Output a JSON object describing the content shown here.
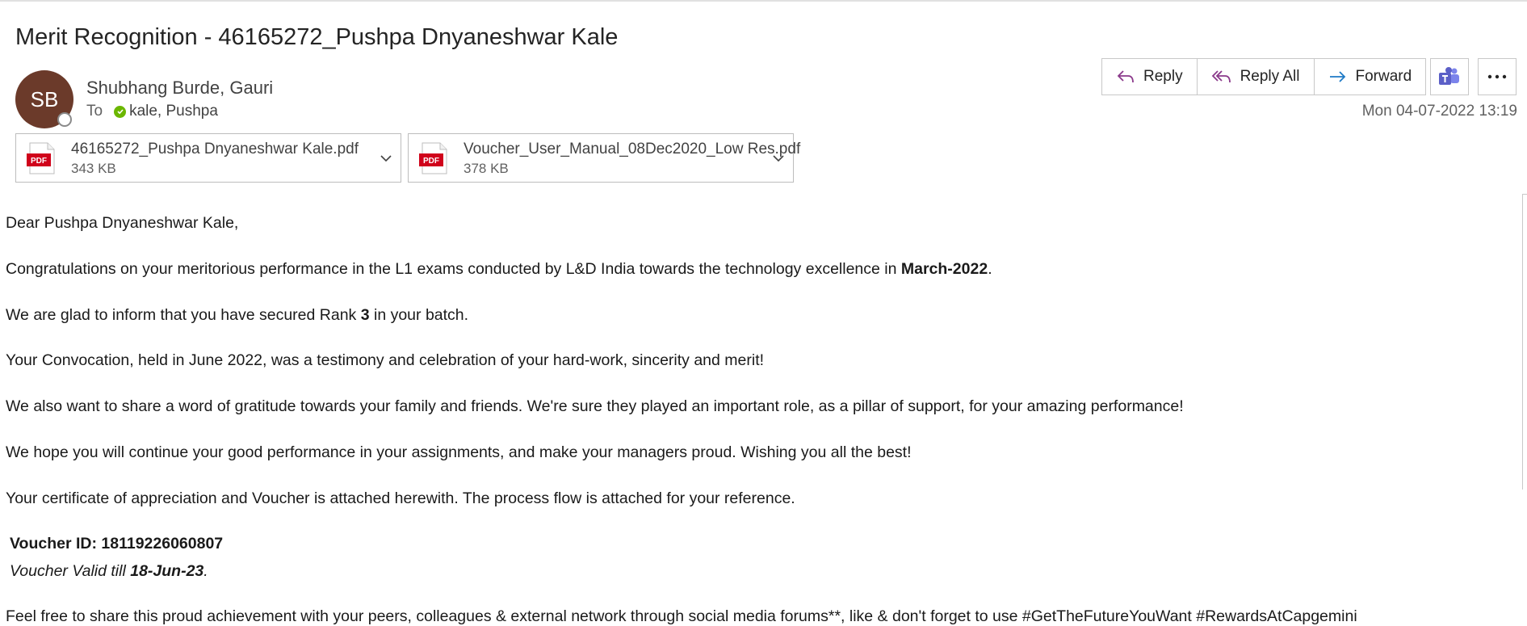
{
  "email": {
    "subject": "Merit Recognition - 46165272_Pushpa Dnyaneshwar Kale",
    "sender_initials": "SB",
    "sender_name": "Shubhang Burde, Gauri",
    "to_label": "To",
    "recipient": "kale, Pushpa",
    "date": "Mon 04-07-2022 13:19"
  },
  "actions": {
    "reply": "Reply",
    "reply_all": "Reply All",
    "forward": "Forward"
  },
  "attachments": [
    {
      "name": "46165272_Pushpa Dnyaneshwar Kale.pdf",
      "size": "343 KB",
      "badge": "PDF"
    },
    {
      "name": "Voucher_User_Manual_08Dec2020_Low Res.pdf",
      "size": "378 KB",
      "badge": "PDF"
    }
  ],
  "body": {
    "greeting": "Dear Pushpa Dnyaneshwar Kale,",
    "p1_a": "Congratulations on your meritorious performance in the L1 exams conducted by L&D India towards the technology excellence in ",
    "p1_bold": "March-2022",
    "p1_end": ".",
    "p2_a": "We are glad to inform that you have secured Rank ",
    "p2_bold": "3",
    "p2_b": " in your batch.",
    "p3": "Your Convocation, held in June 2022, was a testimony and celebration of your hard-work, sincerity and merit!",
    "p4": "We also want to share a word of gratitude towards your family and friends. We're sure they played an important role, as a pillar of support, for your amazing performance!",
    "p5": "We hope you will continue your good performance in your assignments, and make your managers proud. Wishing you all the best!",
    "p6": "Your certificate of appreciation and Voucher is attached herewith. The process flow is attached for your reference.",
    "voucher_id": "Voucher ID: 18119226060807",
    "valid_a": "Voucher Valid till ",
    "valid_date": "18-Jun-23",
    "valid_end": ".",
    "p7_partial": "Feel free to share this proud achievement with your peers, colleagues & external network through social media forums**, like & don't forget to use #GetTheFutureYouWant #RewardsAtCapgemini"
  },
  "colors": {
    "avatar": "#6b3a2a",
    "reply_icon": "#8b3a8b",
    "forward_icon": "#1e7ac6",
    "teams": "#5b5fc7",
    "pdf_red": "#d0021b",
    "presence_available": "#6bb700"
  },
  "icons": [
    "reply-icon",
    "reply-all-icon",
    "forward-icon",
    "teams-icon",
    "more-icon",
    "pdf-icon",
    "chevron-down-icon"
  ]
}
